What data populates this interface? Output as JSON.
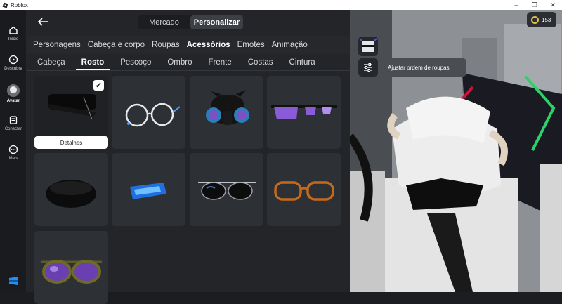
{
  "window": {
    "title": "Roblox",
    "minimize": "–",
    "maximize": "❐",
    "close": "✕"
  },
  "nav": [
    {
      "label": "Início",
      "icon": "home-icon"
    },
    {
      "label": "Descubra",
      "icon": "play-icon"
    },
    {
      "label": "Avatar",
      "icon": "avatar-icon",
      "active": true
    },
    {
      "label": "Conectar",
      "icon": "chat-icon"
    },
    {
      "label": "Mais",
      "icon": "more-icon"
    }
  ],
  "header": {
    "back_icon": "arrow-left-icon",
    "tabs": [
      "Mercado",
      "Personalizar"
    ],
    "active_tab": "Personalizar"
  },
  "categories": {
    "items": [
      "Personagens",
      "Cabeça e corpo",
      "Roupas",
      "Acessórios",
      "Emotes",
      "Animação"
    ],
    "selected": "Acessórios"
  },
  "subcategories": {
    "items": [
      "Cabeça",
      "Rosto",
      "Pescoço",
      "Ombro",
      "Frente",
      "Costas",
      "Cintura"
    ],
    "selected": "Rosto"
  },
  "items": [
    {
      "name": "black-mask-accessory",
      "equipped": true,
      "details_label": "Detalhes"
    },
    {
      "name": "silver-round-glasses"
    },
    {
      "name": "black-gas-mask-with-horns"
    },
    {
      "name": "purple-sunglasses"
    },
    {
      "name": "black-face-band"
    },
    {
      "name": "blue-cyber-visor"
    },
    {
      "name": "black-aviator-sunglasses"
    },
    {
      "name": "brown-glasses"
    },
    {
      "name": "gold-purple-aviators"
    }
  ],
  "robux": {
    "amount": "153"
  },
  "scene": {
    "tooltip": "Ajustar ordem de roupas"
  },
  "colors": {
    "accent": "#ffffff",
    "panel": "#232528",
    "tile": "#2d3034",
    "robux": "#e8c24a"
  }
}
